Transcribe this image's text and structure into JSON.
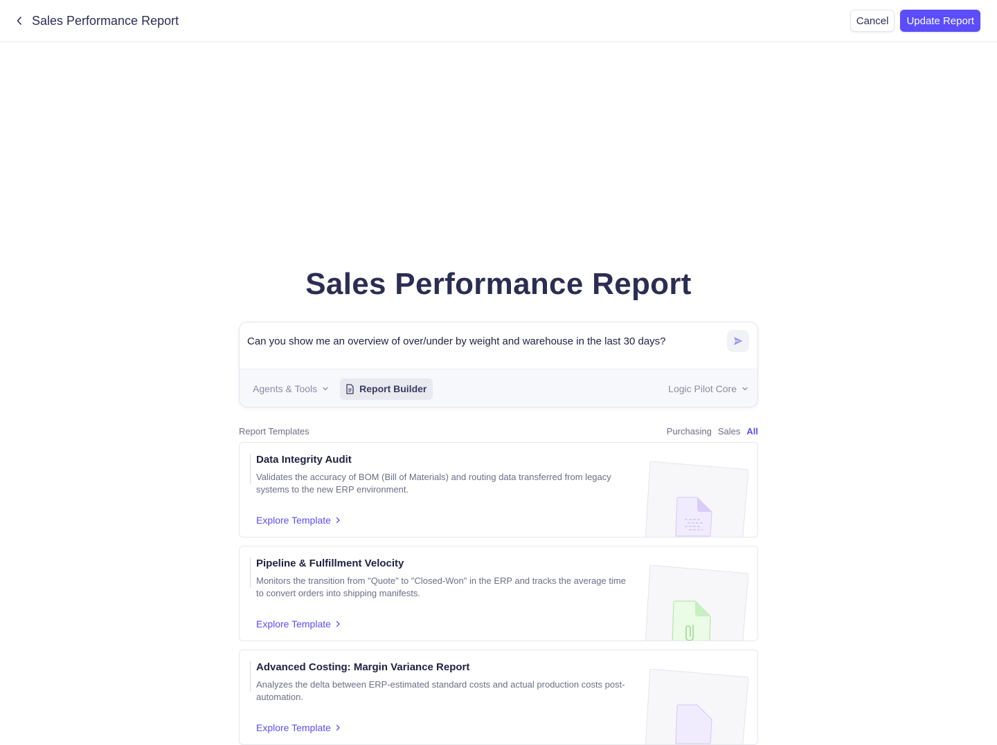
{
  "header": {
    "title": "Sales Performance Report",
    "cancel_label": "Cancel",
    "update_label": "Update Report"
  },
  "hero": {
    "title": "Sales Performance Report"
  },
  "prompt": {
    "text": "Can you show me an overview of over/under by weight and warehouse in the last 30 days?",
    "agents_label": "Agents & Tools",
    "builder_label": "Report Builder",
    "model_label": "Logic Pilot Core"
  },
  "templates": {
    "label": "Report Templates",
    "filters": [
      "Purchasing",
      "Sales",
      "All"
    ],
    "active_filter": "All",
    "items": [
      {
        "title": "Data Integrity Audit",
        "description": "Validates the accuracy of BOM (Bill of Materials) and routing data transferred from legacy systems to the new ERP environment.",
        "link": "Explore Template",
        "icon": "document-lines-icon",
        "accent": "#d9cdf7"
      },
      {
        "title": "Pipeline & Fulfillment Velocity",
        "description": "Monitors the transition from \"Quote\" to \"Closed-Won\" in the ERP and tracks the average time to convert orders into shipping manifests.",
        "link": "Explore Template",
        "icon": "paperclip-document-icon",
        "accent": "#c8f0c0"
      },
      {
        "title": "Advanced Costing: Margin Variance Report",
        "description": "Analyzes the delta between ERP-estimated standard costs and actual production costs post-automation.",
        "link": "Explore Template",
        "icon": "document-icon",
        "accent": "#d9cdf7"
      }
    ]
  },
  "colors": {
    "primary": "#5b4dfa",
    "heading": "#2b2d52",
    "muted": "#6c6e85"
  }
}
